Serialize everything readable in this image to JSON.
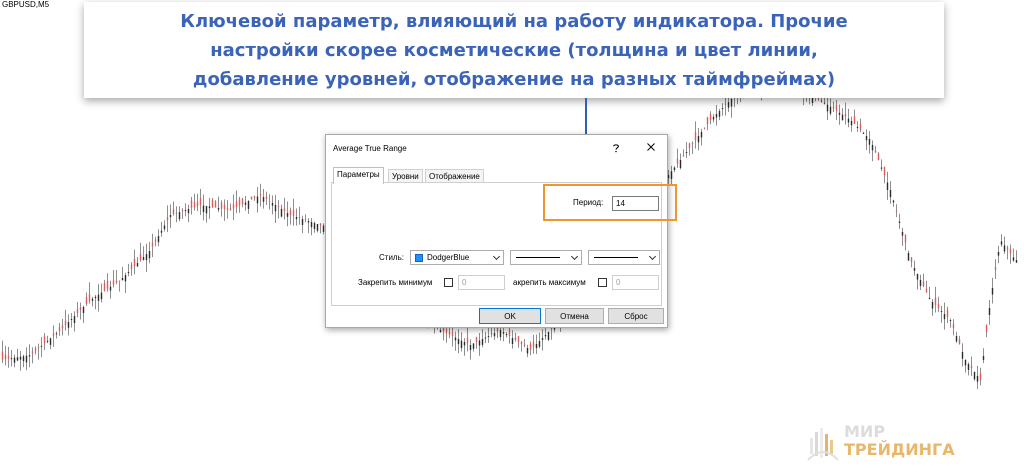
{
  "chart": {
    "symbol": "GBPUSD,M5",
    "bull_color": "#2b2b2b",
    "bear_color": "#e05a5a",
    "wick_color": "#444444"
  },
  "callout": {
    "text": "Ключевой параметр, влияющий на работу индикатора. Прочие\nнастройки скорее косметические (толщина и цвет линии,\nдобавление уровней, отображение на разных таймфреймах)",
    "color": "#3b64b8",
    "arrow_color": "#2f5fb3"
  },
  "dialog": {
    "title": "Average True Range",
    "help_icon": "question-mark-icon",
    "close_icon": "close-icon",
    "tabs": [
      {
        "label": "Параметры",
        "active": true
      },
      {
        "label": "Уровни",
        "active": false
      },
      {
        "label": "Отображение",
        "active": false
      }
    ],
    "period": {
      "label": "Период:",
      "value": "14"
    },
    "style": {
      "label": "Стиль:",
      "color_name": "DodgerBlue",
      "color_hex": "#1e90ff"
    },
    "fix_min": {
      "label": "Закрепить минимум",
      "value": "0",
      "checked": false
    },
    "fix_max": {
      "label": "акрепить максимум",
      "value": "0",
      "checked": false
    },
    "buttons": {
      "ok": "OK",
      "cancel": "Отмена",
      "reset": "Сброс"
    },
    "highlight_color": "#f0962e"
  },
  "brand": {
    "line1": "МИР",
    "line2": "ТРЕЙДИНГА"
  }
}
